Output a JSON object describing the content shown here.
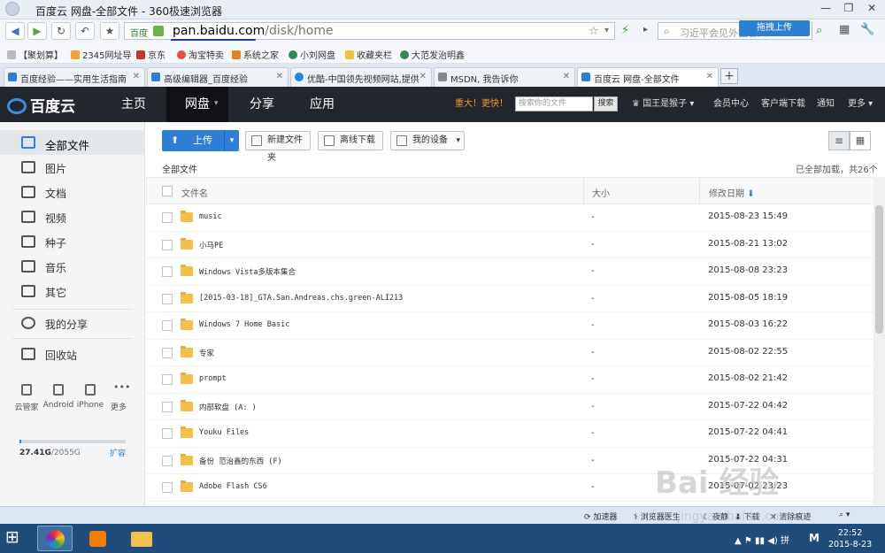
{
  "window": {
    "title": "百度云 网盘-全部文件 - 360极速浏览器"
  },
  "address": {
    "site_tag": "百度",
    "url_host": "pan.baidu.com",
    "url_path": "/disk/home",
    "search_placeholder": "习近平会见外国客人",
    "drag_upload": "拖拽上传"
  },
  "bookmarks": [
    "【聚划算】",
    "2345网址导",
    "京东",
    "淘宝特卖",
    "系统之家",
    "小刘网盘",
    "收藏夹栏",
    "大范发治明鑫"
  ],
  "tabs": [
    {
      "label": "百度经验——实用生活指南",
      "color": "#2d7fd3"
    },
    {
      "label": "高级编辑器_百度经验",
      "color": "#2d7fd3"
    },
    {
      "label": "优酷-中国领先视频网站,提供",
      "color": "#1e88e5"
    },
    {
      "label": "MSDN, 我告诉你",
      "color": "#888888"
    },
    {
      "label": "百度云 网盘-全部文件",
      "color": "#2d7fd3",
      "active": true
    }
  ],
  "header": {
    "logo": "百度云",
    "nav": [
      "主页",
      "网盘",
      "分享",
      "应用"
    ],
    "promo": "重大！更快！",
    "search_placeholder": "搜索你的文件",
    "search_button": "搜索",
    "username": "国王是猴子",
    "links": [
      "会员中心",
      "客户端下载",
      "通知",
      "更多"
    ]
  },
  "sidebar": {
    "items": [
      "全部文件",
      "图片",
      "文档",
      "视频",
      "种子",
      "音乐",
      "其它",
      "我的分享",
      "回收站"
    ],
    "devices": [
      "云管家",
      "Android",
      "iPhone",
      "更多"
    ],
    "quota_used": "27.41G",
    "quota_total": "2055G",
    "quota_fraction": 0.013,
    "expand": "扩容"
  },
  "toolbar": {
    "upload": "上传",
    "new_folder": "新建文件夹",
    "offline": "离线下载",
    "devices": "我的设备"
  },
  "crumb": {
    "path": "全部文件",
    "loaded": "已全部加载，共26个"
  },
  "columns": {
    "name": "文件名",
    "size": "大小",
    "date": "修改日期"
  },
  "files": [
    {
      "name": "music",
      "size": "-",
      "date": "2015-08-23 15:49"
    },
    {
      "name": "小马PE",
      "size": "-",
      "date": "2015-08-21 13:02"
    },
    {
      "name": "Windows Vista多版本集合",
      "size": "-",
      "date": "2015-08-08 23:23"
    },
    {
      "name": "[2015-03-18]_GTA.San.Andreas.chs.green-ALI213",
      "size": "-",
      "date": "2015-08-05 18:19"
    },
    {
      "name": "Windows 7 Home Basic",
      "size": "-",
      "date": "2015-08-03 16:22"
    },
    {
      "name": "专家",
      "size": "-",
      "date": "2015-08-02 22:55"
    },
    {
      "name": "prompt",
      "size": "-",
      "date": "2015-08-02 21:42"
    },
    {
      "name": "内部软盘 (A: )",
      "size": "-",
      "date": "2015-07-22 04:42"
    },
    {
      "name": "Youku Files",
      "size": "-",
      "date": "2015-07-22 04:41"
    },
    {
      "name": "备份 范治鑫的东西 (F)",
      "size": "-",
      "date": "2015-07-22 04:31"
    },
    {
      "name": "Adobe Flash CS6",
      "size": "-",
      "date": "2015-07-02 23:23"
    }
  ],
  "statusbar": [
    "加速器",
    "浏览器医生",
    "夜静",
    "下载",
    "清除痕迹"
  ],
  "taskbar": {
    "time": "22:52",
    "date": "2015-8-23"
  },
  "watermark": {
    "text": "Bai 经验",
    "url": "jingyan.baidu.com"
  }
}
